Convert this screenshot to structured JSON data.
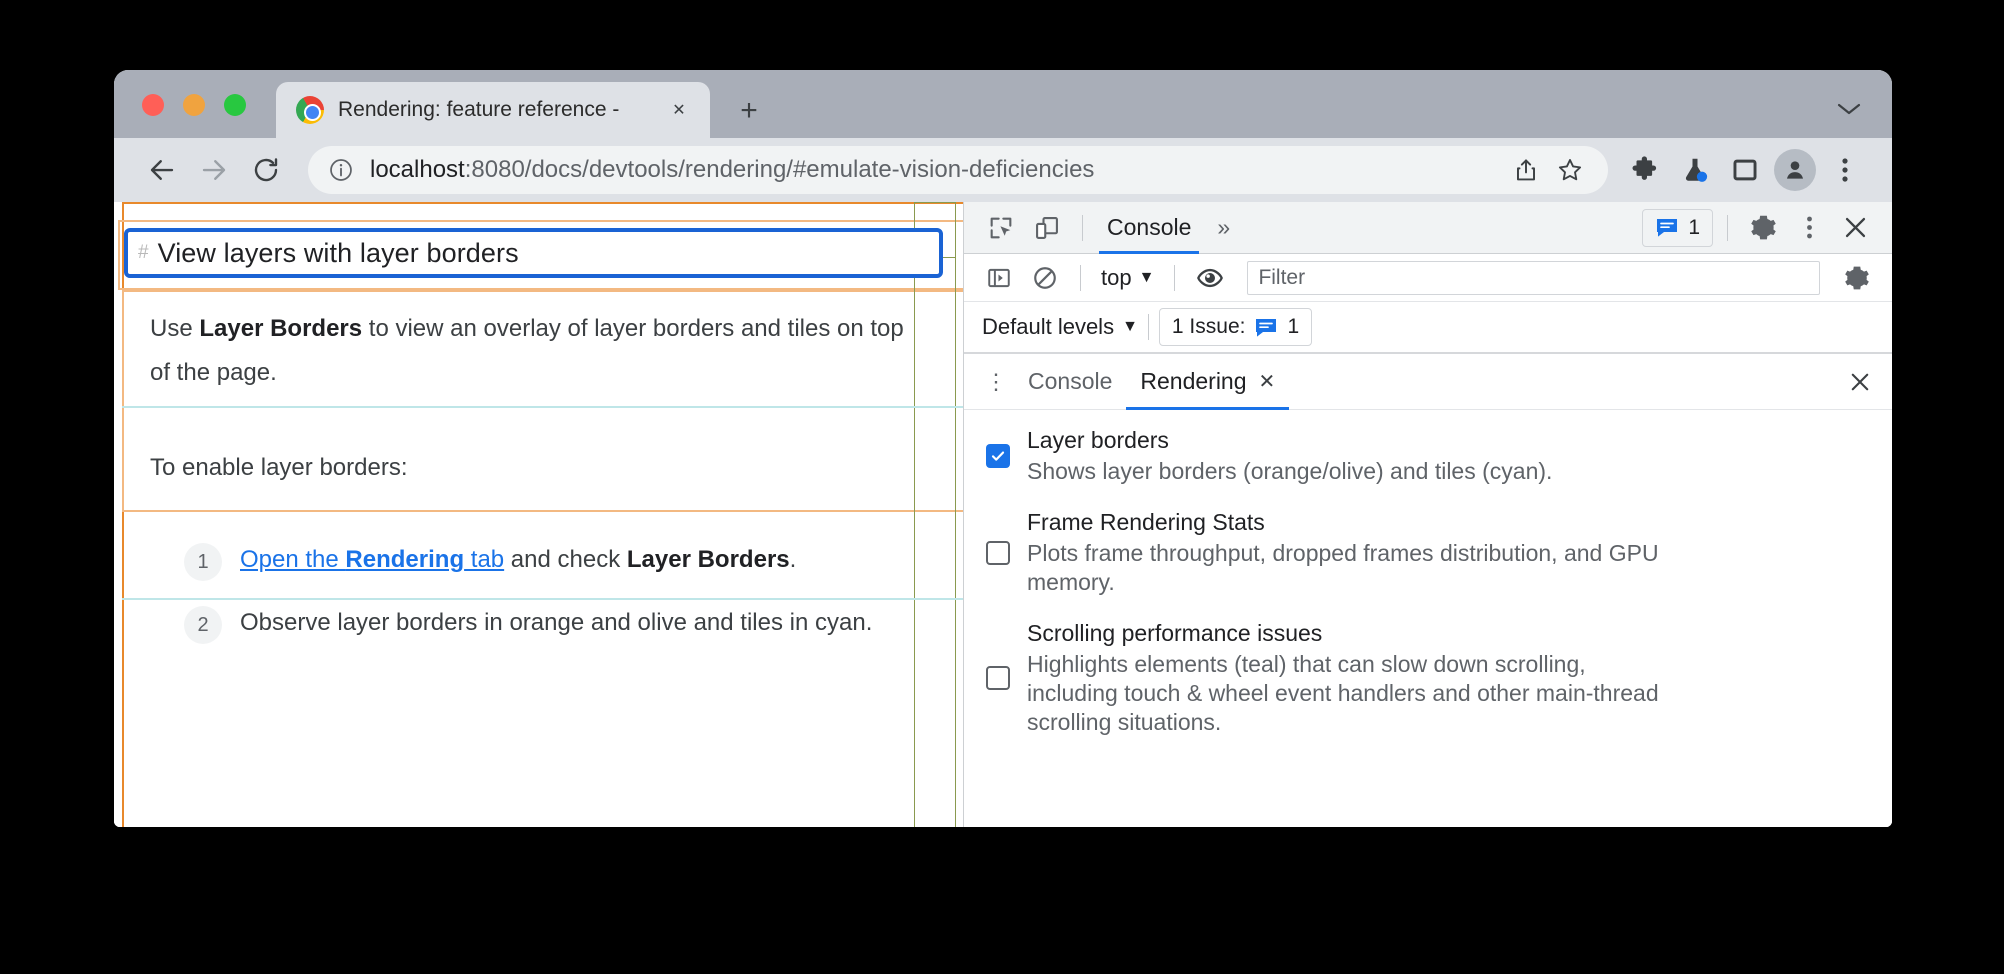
{
  "window": {
    "traffic_lights": [
      "close",
      "minimize",
      "maximize"
    ],
    "tab": {
      "title": "Rendering: feature reference -",
      "close_label": "✕",
      "favicon": "chrome-logo-icon"
    },
    "new_tab_label": "+",
    "window_menu_label": "⌄"
  },
  "toolbar": {
    "back_label": "←",
    "forward_label": "→",
    "reload_label": "↻",
    "site_info_icon": "info-circle-icon",
    "url_host": "localhost",
    "url_rest": ":8080/docs/devtools/rendering/#emulate-vision-deficiencies",
    "share_icon": "share-icon",
    "bookmark_icon": "star-icon",
    "extensions_icon": "puzzle-icon",
    "experiments_icon": "flask-icon",
    "side_panel_icon": "side-panel-icon",
    "profile_icon": "avatar-icon",
    "menu_icon": "three-dot-menu-icon"
  },
  "page": {
    "heading_anchor": "#",
    "heading": "View layers with layer borders",
    "paragraph_1_pre": "Use ",
    "paragraph_1_bold": "Layer Borders",
    "paragraph_1_post": " to view an overlay of layer borders and tiles on top of the page.",
    "paragraph_2": "To enable layer borders:",
    "steps": [
      {
        "number": "1",
        "link_pre": "Open the ",
        "link_bold": "Rendering",
        "link_post": " tab",
        "after_pre": " and check ",
        "after_bold": "Layer Borders",
        "after_post": "."
      },
      {
        "number": "2",
        "text": "Observe layer borders in orange and olive and tiles in cyan."
      }
    ],
    "overlay_colors": {
      "layer_border_orange": "#e8892c",
      "layer_border_light_orange": "#f3b982",
      "layer_border_olive": "#8a9a4f",
      "tile_cyan": "#bfe6e8",
      "focus_blue": "#1a63d4"
    }
  },
  "devtools": {
    "inspect_icon": "inspect-element-icon",
    "device_toolbar_icon": "device-toolbar-icon",
    "main_tab": "Console",
    "more_tabs_label": "»",
    "issue_badge_count": "1",
    "settings_icon": "gear-icon",
    "more_options_icon": "three-dot-menu-icon",
    "close_icon": "close-icon",
    "console_sidebar_icon": "console-sidebar-icon",
    "clear_console_icon": "clear-console-icon",
    "context_selector": "top",
    "context_caret": "▼",
    "eye_icon": "live-expression-eye-icon",
    "filter_placeholder": "Filter",
    "console_settings_icon": "gear-icon",
    "levels_label": "Default levels",
    "levels_caret": "▼",
    "issues_label": "1 Issue:",
    "issues_count": "1",
    "drawer": {
      "kebab_label": "⋮",
      "tabs": [
        {
          "label": "Console",
          "active": false,
          "closable": false
        },
        {
          "label": "Rendering",
          "active": true,
          "closable": true,
          "close_label": "✕"
        }
      ],
      "close_label": "✕"
    },
    "rendering_settings": [
      {
        "title": "Layer borders",
        "description": "Shows layer borders (orange/olive) and tiles (cyan).",
        "checked": true
      },
      {
        "title": "Frame Rendering Stats",
        "description": "Plots frame throughput, dropped frames distribution, and GPU memory.",
        "checked": false
      },
      {
        "title": "Scrolling performance issues",
        "description": "Highlights elements (teal) that can slow down scrolling, including touch & wheel event handlers and other main-thread scrolling situations.",
        "checked": false
      }
    ]
  }
}
